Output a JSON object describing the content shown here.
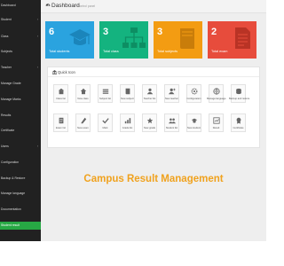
{
  "header": {
    "title": "Dashboard",
    "subtitle": "Control panel"
  },
  "sidebar": {
    "items": [
      {
        "label": "Dashboard",
        "active": false,
        "has_arrow": false
      },
      {
        "label": "Student",
        "active": false,
        "has_arrow": true
      },
      {
        "label": "Class",
        "active": false,
        "has_arrow": true
      },
      {
        "label": "Subjects",
        "active": false,
        "has_arrow": false
      },
      {
        "label": "Teacher",
        "active": false,
        "has_arrow": true
      },
      {
        "label": "Manage Grade",
        "active": false,
        "has_arrow": false
      },
      {
        "label": "Manage Marks",
        "active": false,
        "has_arrow": false
      },
      {
        "label": "Results",
        "active": false,
        "has_arrow": false
      },
      {
        "label": "Certificate",
        "active": false,
        "has_arrow": false
      },
      {
        "label": "Users",
        "active": false,
        "has_arrow": true
      },
      {
        "label": "Configuration",
        "active": false,
        "has_arrow": false
      },
      {
        "label": "Backup & Restore",
        "active": false,
        "has_arrow": false
      },
      {
        "label": "Manage language",
        "active": false,
        "has_arrow": false
      },
      {
        "label": "Documentation",
        "active": false,
        "has_arrow": false
      },
      {
        "label": "Student result",
        "active": true,
        "has_arrow": false
      }
    ]
  },
  "stats": [
    {
      "count": "6",
      "label": "Total students",
      "color": "#2aa3df",
      "icon": "graduation-cap-icon"
    },
    {
      "count": "3",
      "label": "Total class",
      "color": "#14b37f",
      "icon": "hierarchy-icon"
    },
    {
      "count": "3",
      "label": "Total subjects",
      "color": "#f39c12",
      "icon": "book-icon"
    },
    {
      "count": "2",
      "label": "Total exam",
      "color": "#e74c3c",
      "icon": "document-icon"
    }
  ],
  "quick_icons": {
    "title": "Quick Icon",
    "items": [
      {
        "label": "Class list",
        "icon": "class-list-icon"
      },
      {
        "label": "New class",
        "icon": "new-class-icon"
      },
      {
        "label": "Subject list",
        "icon": "subject-list-icon"
      },
      {
        "label": "New subject",
        "icon": "new-subject-icon"
      },
      {
        "label": "Teacher list",
        "icon": "teacher-list-icon"
      },
      {
        "label": "New teacher",
        "icon": "new-teacher-icon"
      },
      {
        "label": "Configuration",
        "icon": "configuration-icon"
      },
      {
        "label": "Manage language",
        "icon": "language-icon"
      },
      {
        "label": "Backup and restore",
        "icon": "backup-icon"
      },
      {
        "label": "Exam list",
        "icon": "exam-list-icon"
      },
      {
        "label": "New exam",
        "icon": "new-exam-icon"
      },
      {
        "label": "Mark",
        "icon": "mark-icon"
      },
      {
        "label": "Grade list",
        "icon": "grade-list-icon"
      },
      {
        "label": "New grade",
        "icon": "new-grade-icon"
      },
      {
        "label": "Student list",
        "icon": "student-list-icon"
      },
      {
        "label": "New student",
        "icon": "new-student-icon"
      },
      {
        "label": "Result",
        "icon": "result-icon"
      },
      {
        "label": "Certificate",
        "icon": "certificate-icon"
      }
    ]
  },
  "banner": {
    "text": "Campus Result Management",
    "color": "#f0a21e"
  }
}
